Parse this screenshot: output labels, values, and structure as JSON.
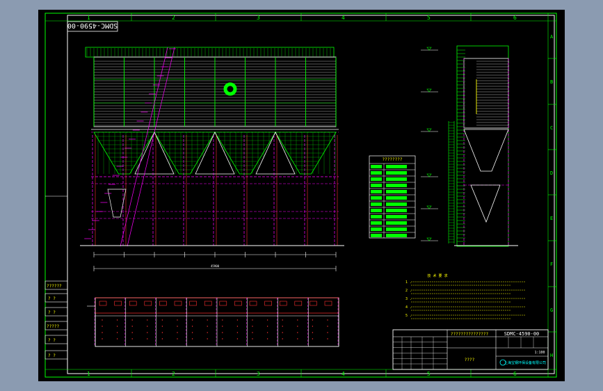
{
  "colors": {
    "background": "#8b9bb1",
    "sheet": "#000000",
    "border": "#ffffff",
    "frame": "#00ff00",
    "line_green": "#00ff00",
    "line_magenta": "#ff00ff",
    "line_red": "#ff3030",
    "line_cyan": "#00ffff",
    "line_yellow": "#ffff00",
    "line_white": "#ffffff"
  },
  "zone_numbers_top": [
    "1",
    "2",
    "3",
    "4",
    "5",
    "6"
  ],
  "zone_numbers_bottom": [
    "1",
    "2",
    "3",
    "4",
    "5",
    "6"
  ],
  "zone_letters_right": [
    "A",
    "B",
    "C",
    "D",
    "E",
    "F",
    "G",
    "H"
  ],
  "drawing_number_rotated": "SDMC-4590-00",
  "left_stamp_labels": [
    "??????",
    "? ?",
    "? ?",
    "?????",
    "? ?",
    "? ?"
  ],
  "spec_table": {
    "title": "????????",
    "row_count": 12
  },
  "notes": {
    "heading": "技 术 要 求",
    "lines": [
      "1 .",
      "2 .",
      "3 .",
      "4 .",
      "5 ."
    ]
  },
  "title_block": {
    "project_name": "???????????????",
    "drawing_name": "????",
    "drawing_number": "SDMC-4590-00",
    "company": "上海宝钢环保设备有限公司",
    "scale_label": "1:100"
  },
  "dimension_labels": {
    "total_length": "45900",
    "bay": "6000"
  }
}
